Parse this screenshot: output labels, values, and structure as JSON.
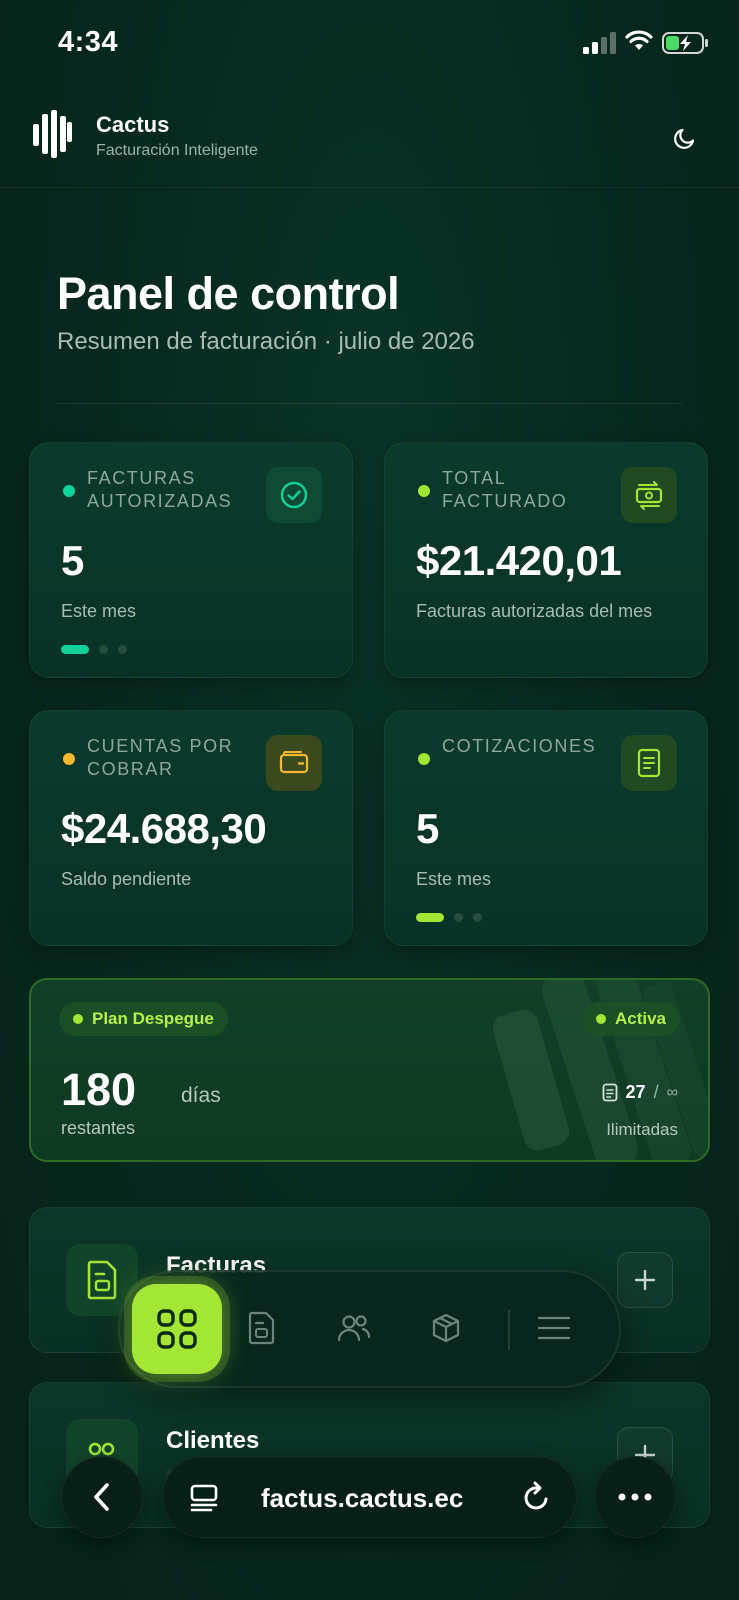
{
  "status_bar": {
    "time": "4:34"
  },
  "header": {
    "brand": "Cactus",
    "tagline": "Facturación Inteligente"
  },
  "page": {
    "title": "Panel de control",
    "subtitle": "Resumen de facturación · julio de 2026"
  },
  "cards": [
    {
      "label": "FACTURAS AUTORIZADAS",
      "value": "5",
      "note": "Este mes",
      "dot_color": "#10d39a",
      "icon": "check-circle-icon",
      "pager_active": 0,
      "pager_count": 3
    },
    {
      "label": "TOTAL FACTURADO",
      "value": "$21.420,01",
      "note": "Facturas autorizadas del mes",
      "dot_color": "#a3e635",
      "icon": "money-exchange-icon"
    },
    {
      "label": "CUENTAS POR COBRAR",
      "value": "$24.688,30",
      "note": "Saldo pendiente",
      "dot_color": "#f5b82e",
      "icon": "wallet-icon"
    },
    {
      "label": "COTIZACIONES",
      "value": "5",
      "note": "Este mes",
      "dot_color": "#a3e635",
      "icon": "document-icon",
      "pager_active": 0,
      "pager_count": 3
    }
  ],
  "plan": {
    "name": "Plan Despegue",
    "status": "Activa",
    "days": "180",
    "days_unit": "días",
    "days_label": "restantes",
    "docs_used": "27",
    "docs_sep": "/",
    "docs_limit": "∞",
    "limit_label": "Ilimitadas"
  },
  "sections": [
    {
      "title": "Facturas",
      "icon": "invoice-icon"
    },
    {
      "title": "Clientes",
      "icon": "clients-icon"
    }
  ],
  "tabbar": {
    "items": [
      "dashboard-icon",
      "invoice-icon",
      "users-icon",
      "box-icon",
      "menu-icon"
    ],
    "active": "dashboard-icon"
  },
  "browser": {
    "url": "factus.cactus.ec"
  },
  "colors": {
    "accent": "#a3e635",
    "teal": "#10d39a",
    "amber": "#f5b82e",
    "background": "#06251c"
  }
}
